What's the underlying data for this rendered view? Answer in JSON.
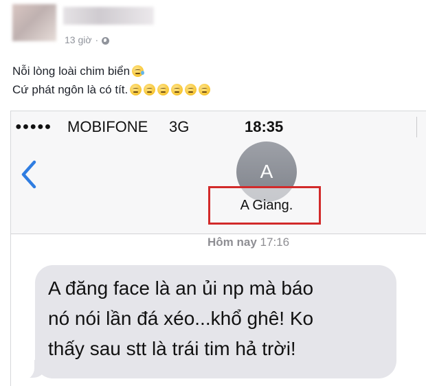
{
  "post": {
    "time": "13 giờ",
    "separator": "·",
    "text_line_1": "Nỗi lòng loài chim biển",
    "text_line_2": "Cứ phát ngôn là có tít."
  },
  "screenshot": {
    "status_bar": {
      "signal_dots": "●●●●●",
      "carrier": "MOBIFONE",
      "network": "3G",
      "time": "18:35"
    },
    "contact": {
      "initial": "A",
      "name": "A Giang."
    },
    "date_label": "Hôm nay",
    "date_time": "17:16",
    "message": "A đăng face là an ủi np mà báo\nnó nói lần đá xéo...khổ ghê! Ko\nthấy sau stt là trái tim hả trời!"
  },
  "colors": {
    "highlight_box": "#d22a2a",
    "ios_blue": "#2f7de1",
    "bubble": "#e5e5ea"
  },
  "icons": [
    "globe-icon",
    "back-chevron-icon",
    "emoji-icon"
  ]
}
